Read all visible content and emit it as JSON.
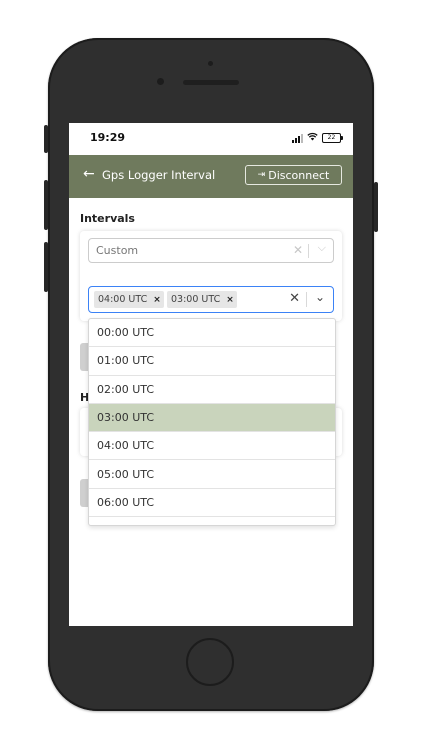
{
  "status": {
    "time": "19:29",
    "battery": "22"
  },
  "header": {
    "title": "Gps Logger Interval",
    "disconnect_label": "Disconnect"
  },
  "intervals": {
    "label": "Intervals",
    "mode_select": "Custom",
    "selected_tags": [
      "04:00 UTC",
      "03:00 UTC"
    ]
  },
  "second_section": {
    "label_partial": "H"
  },
  "dropdown": {
    "options": [
      "00:00 UTC",
      "01:00 UTC",
      "02:00 UTC",
      "03:00 UTC",
      "04:00 UTC",
      "05:00 UTC",
      "06:00 UTC"
    ],
    "highlighted": "03:00 UTC"
  },
  "colors": {
    "header_bg": "#6f7a5d",
    "highlight": "#c9d4bc",
    "focus_border": "#3b82f6"
  }
}
